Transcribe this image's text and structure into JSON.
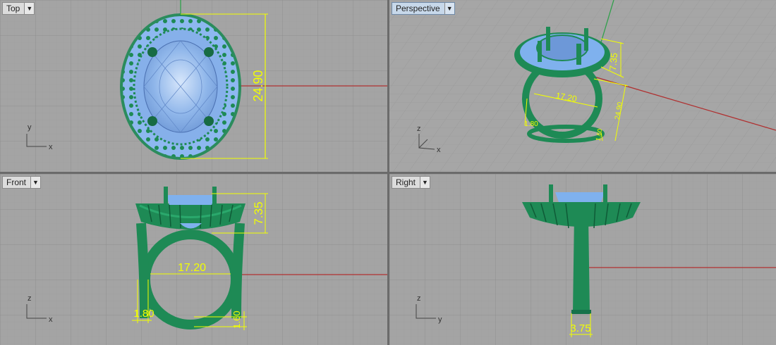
{
  "viewports": {
    "top": {
      "title": "Top",
      "axis_h": "x",
      "axis_v": "y",
      "dims": {
        "height": "24.90"
      }
    },
    "perspective": {
      "title": "Perspective",
      "axis_h": "x",
      "axis_v": "z",
      "dims": {
        "head": "7.35",
        "inner": "17.20",
        "total": "24.90",
        "band_side": "1.80",
        "band_bottom": "1.60"
      }
    },
    "front": {
      "title": "Front",
      "axis_h": "x",
      "axis_v": "z",
      "dims": {
        "head": "7.35",
        "inner": "17.20",
        "band_side": "1.80",
        "band_bottom": "1.60"
      }
    },
    "right": {
      "title": "Right",
      "axis_h": "y",
      "axis_v": "z",
      "dims": {
        "shank": "3.75"
      }
    }
  },
  "colors": {
    "viewport_bg": "#a4a4a4",
    "grid": "#999999",
    "dimension": "#f2ff00",
    "metal": "#1f8a5c",
    "stone": "#7fb1ee",
    "x_axis": "#b03030",
    "y_axis": "#2fa04a"
  },
  "icons": {
    "dropdown": "triangle-down"
  }
}
